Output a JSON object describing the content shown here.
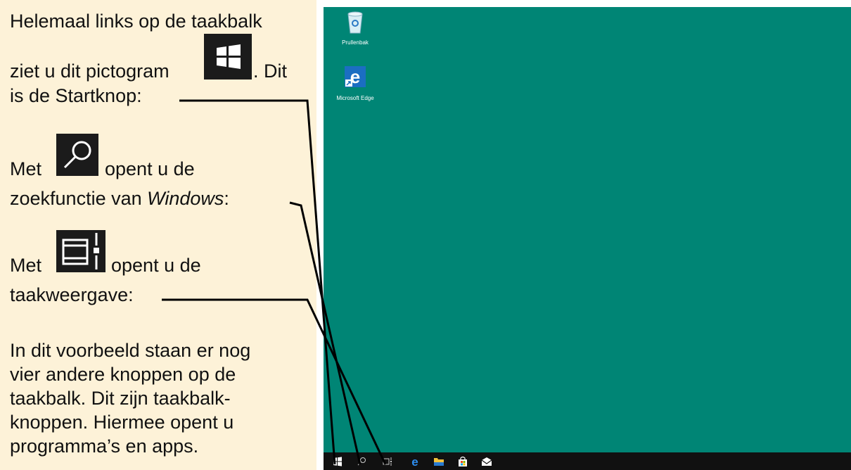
{
  "explanation": {
    "line1": "Helemaal links op de taakbalk",
    "line2": "ziet u dit pictogram",
    "line2_suffix": ". Dit",
    "line3": "is de Startknop:",
    "line4_prefix": "Met",
    "line4_suffix": "opent u de",
    "line5_prefix": "zoekfunctie van ",
    "line5_italic": "Windows",
    "line5_suffix": ":",
    "line6_prefix": "Met",
    "line6_suffix": "opent u de",
    "line7": "taakweergave:",
    "para": [
      "In dit voorbeeld staan er nog",
      "vier andere knoppen op de",
      "taakbalk. Dit zijn taakbalk-",
      "knoppen. Hiermee opent u",
      "programma’s en apps."
    ]
  },
  "desktop": {
    "background": "#008575",
    "icons": [
      {
        "label": "Prullenbak",
        "icon": "recycle-bin-icon"
      },
      {
        "label": "Microsoft Edge",
        "icon": "edge-icon"
      }
    ]
  },
  "taskbar": {
    "buttons": [
      {
        "name": "start-button",
        "icon": "windows-logo-icon"
      },
      {
        "name": "search-button",
        "icon": "search-icon"
      },
      {
        "name": "task-view-button",
        "icon": "task-view-icon"
      },
      {
        "name": "edge-taskbar-button",
        "icon": "edge-icon"
      },
      {
        "name": "file-explorer-button",
        "icon": "folder-icon"
      },
      {
        "name": "store-button",
        "icon": "store-icon"
      },
      {
        "name": "mail-button",
        "icon": "mail-icon"
      }
    ]
  }
}
